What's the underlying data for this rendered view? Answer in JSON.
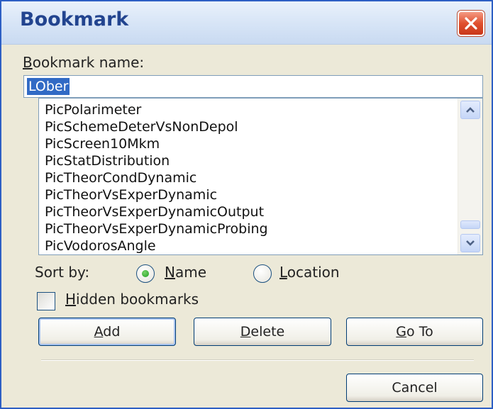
{
  "window": {
    "title": "Bookmark"
  },
  "name_field": {
    "label_mnemonic": "B",
    "label_rest": "ookmark name:",
    "value": "LOber"
  },
  "bookmark_list": {
    "items": [
      "PicPolarimeter",
      "PicSchemeDeterVsNonDepol",
      "PicScreen10Mkm",
      "PicStatDistribution",
      "PicTheorCondDynamic",
      "PicTheorVsExperDynamic",
      "PicTheorVsExperDynamicOutput",
      "PicTheorVsExperDynamicProbing",
      "PicVodorosAngle"
    ]
  },
  "sort": {
    "label": "Sort by:",
    "name_option": {
      "mnemonic": "N",
      "rest": "ame",
      "selected": true
    },
    "location_option": {
      "mnemonic": "L",
      "rest": "ocation",
      "selected": false
    }
  },
  "hidden_bookmarks": {
    "mnemonic": "H",
    "rest": "idden bookmarks",
    "checked": false
  },
  "buttons": {
    "add": {
      "mnemonic": "A",
      "rest": "dd"
    },
    "delete": {
      "mnemonic": "D",
      "rest": "elete"
    },
    "goto": {
      "mnemonic": "G",
      "rest": "o To"
    },
    "cancel": "Cancel"
  },
  "icons": {
    "close": "close-icon",
    "scroll_up": "chevron-up-icon",
    "scroll_down": "chevron-down-icon"
  },
  "colors": {
    "title_text": "#22448f",
    "selection": "#316ac5",
    "radio_dot": "#21a121",
    "close_button": "#e0502f"
  }
}
